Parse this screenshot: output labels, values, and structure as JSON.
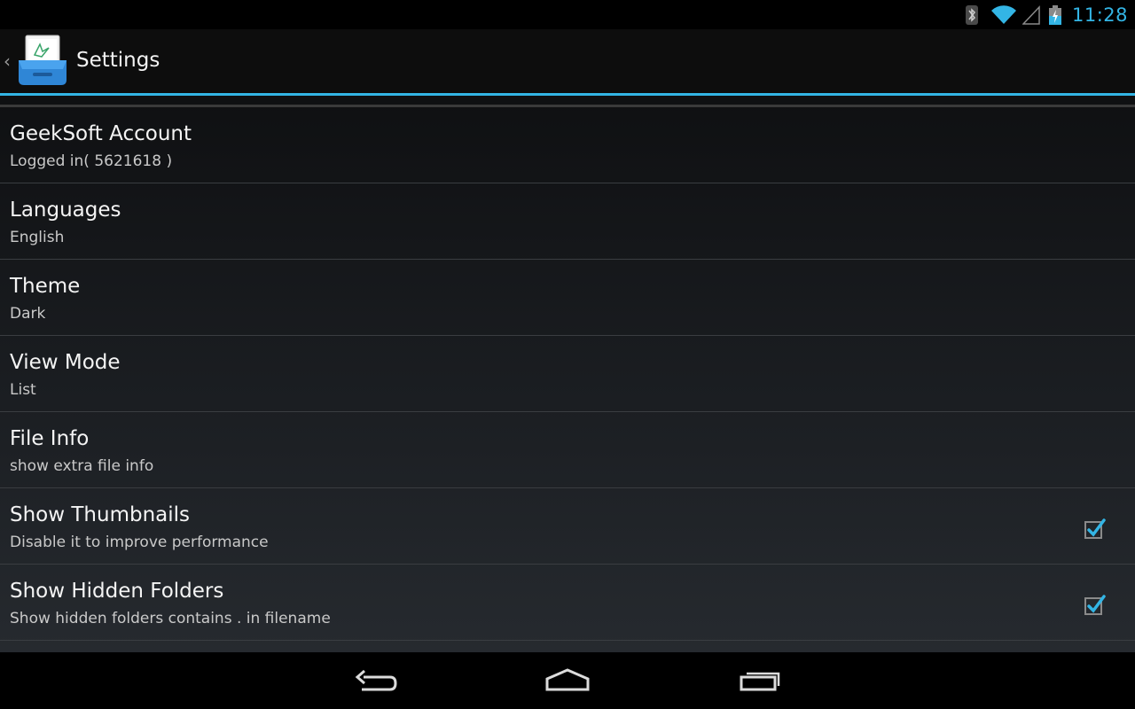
{
  "status_bar": {
    "time": "11:28",
    "icons": [
      "bluetooth-icon",
      "wifi-icon",
      "cell-signal-icon",
      "battery-charging-icon"
    ]
  },
  "action_bar": {
    "title": "Settings",
    "icon": "app-icon"
  },
  "preferences": [
    {
      "title": "GeekSoft Account",
      "summary": "Logged in( 5621618 )",
      "has_checkbox": false
    },
    {
      "title": "Languages",
      "summary": "English",
      "has_checkbox": false
    },
    {
      "title": "Theme",
      "summary": "Dark",
      "has_checkbox": false
    },
    {
      "title": "View Mode",
      "summary": "List",
      "has_checkbox": false
    },
    {
      "title": "File Info",
      "summary": "show extra file info",
      "has_checkbox": false
    },
    {
      "title": "Show Thumbnails",
      "summary": "Disable it to improve performance",
      "has_checkbox": true,
      "checked": true
    },
    {
      "title": "Show Hidden Folders",
      "summary": "Show hidden folders contains . in filename",
      "has_checkbox": true,
      "checked": true
    }
  ],
  "nav_bar": {
    "buttons": [
      "back-icon",
      "home-icon",
      "recent-apps-icon"
    ]
  },
  "colors": {
    "accent": "#33b5e5",
    "background": "#000000"
  }
}
